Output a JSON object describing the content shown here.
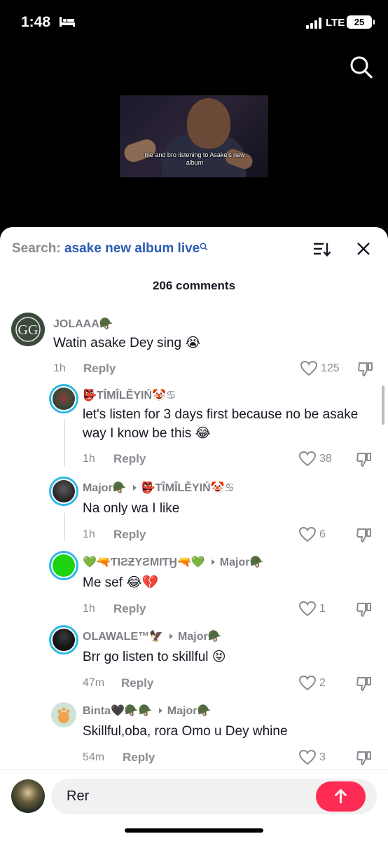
{
  "status_bar": {
    "time": "1:48",
    "network": "LTE",
    "battery": "25"
  },
  "video": {
    "caption": "me and bro listening to Asake's new album"
  },
  "sheet": {
    "search_label": "Search:",
    "search_query": "asake new album live",
    "comment_count": "206 comments"
  },
  "comments": [
    {
      "username": "JOLAAA🪖",
      "text": "Watin asake Dey sing 😭",
      "time": "1h",
      "reply": "Reply",
      "likes": "125"
    },
    {
      "username": "👺TÎMÎLĚYIŃ🤡♋",
      "reply_to": "",
      "text": "let's listen for 3 days first because no be asake way I know be this 😂",
      "time": "1h",
      "reply": "Reply",
      "likes": "38"
    },
    {
      "username": "Major🪖",
      "reply_to": "👺TÎMÎLĚYIŃ🤡♋",
      "text": "Na only wa I like",
      "time": "1h",
      "reply": "Reply",
      "likes": "6"
    },
    {
      "username": "💚🔫ƬIƧƵYƧMIƬӇ🔫💚",
      "reply_to": "Major🪖",
      "text": "Me sef 😂💔",
      "time": "1h",
      "reply": "Reply",
      "likes": "1"
    },
    {
      "username": "OLAWALE™🦅",
      "reply_to": "Major🪖",
      "text": "Brr go listen to skillful 😝",
      "time": "47m",
      "reply": "Reply",
      "likes": "2"
    },
    {
      "username": "Binta🖤🪖🪖",
      "reply_to": "Major🪖",
      "text": "Skillful,oba, rora Omo u Dey whine",
      "time": "54m",
      "reply": "Reply",
      "likes": "3"
    }
  ],
  "composer": {
    "value": "Rer"
  },
  "colors": {
    "accent_red": "#fe2c55",
    "query_blue": "#2b5bb3",
    "ring_blue": "#2fb8e6"
  }
}
